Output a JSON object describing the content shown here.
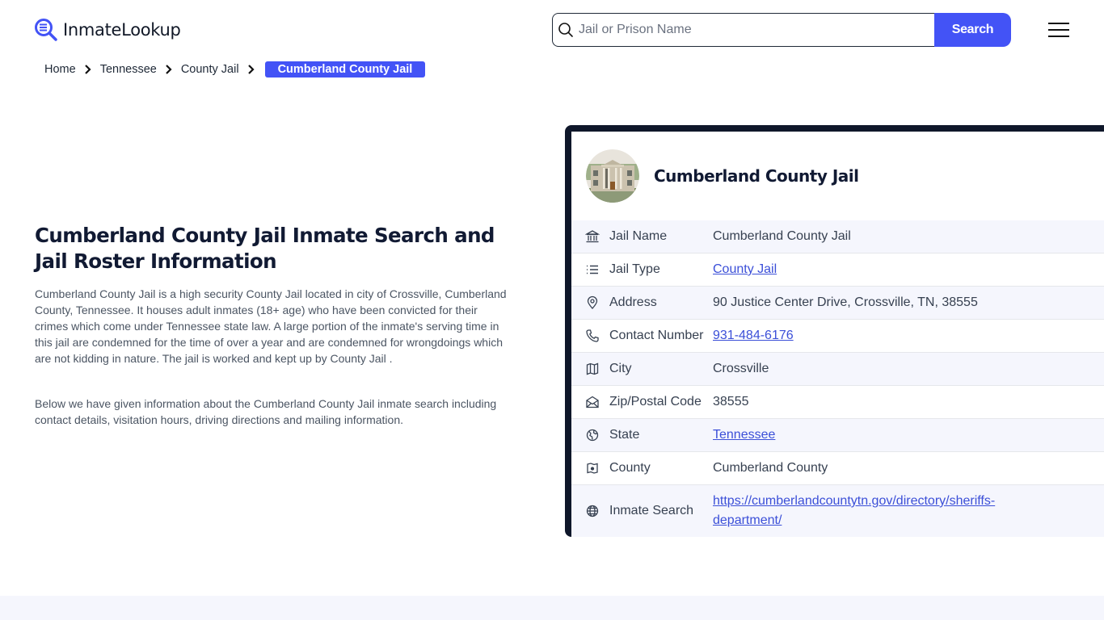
{
  "brand": {
    "name": "InmateLookup",
    "accent": "#4353f6",
    "dark": "#0f172a"
  },
  "search": {
    "placeholder": "Jail or Prison Name",
    "value": "",
    "button_label": "Search"
  },
  "menu": {
    "icon": "hamburger-menu-icon"
  },
  "breadcrumb": {
    "items": [
      {
        "label": "Home"
      },
      {
        "label": "Tennessee"
      },
      {
        "label": "County Jail"
      }
    ],
    "current": "Cumberland County Jail"
  },
  "main": {
    "title": "Cumberland County Jail Inmate Search and Jail Roster Information",
    "paragraphs": [
      "Cumberland County Jail is a high security County Jail located in city of Crossville, Cumberland County, Tennessee. It houses adult inmates (18+ age) who have been convicted for their crimes which come under Tennessee state law. A large portion of the inmate's serving time in this jail are condemned for the time of over a year and are condemned for wrongdoings which are not kidding in nature. The jail is worked and kept up by County Jail .",
      "Below we have given information about the Cumberland County Jail inmate search including contact details, visitation hours, driving directions and mailing information."
    ]
  },
  "card": {
    "title": "Cumberland County Jail",
    "rows": [
      {
        "icon": "building-icon",
        "label": "Jail Name",
        "value": "Cumberland County Jail",
        "link": false
      },
      {
        "icon": "list-icon",
        "label": "Jail Type",
        "value": "County Jail",
        "link": true
      },
      {
        "icon": "map-pin-icon",
        "label": "Address",
        "value": "90 Justice Center Drive, Crossville, TN, 38555",
        "link": false
      },
      {
        "icon": "phone-icon",
        "label": "Contact Number",
        "value": "931-484-6176",
        "link": true
      },
      {
        "icon": "map-icon",
        "label": "City",
        "value": "Crossville",
        "link": false
      },
      {
        "icon": "mail-open-icon",
        "label": "Zip/Postal Code",
        "value": "38555",
        "link": false
      },
      {
        "icon": "globe-region-icon",
        "label": "State",
        "value": "Tennessee",
        "link": true
      },
      {
        "icon": "county-map-icon",
        "label": "County",
        "value": "Cumberland County",
        "link": false
      },
      {
        "icon": "globe-icon",
        "label": "Inmate Search",
        "value": "https://cumberlandcountytn.gov/directory/sheriffs-department/",
        "link": true
      }
    ]
  }
}
